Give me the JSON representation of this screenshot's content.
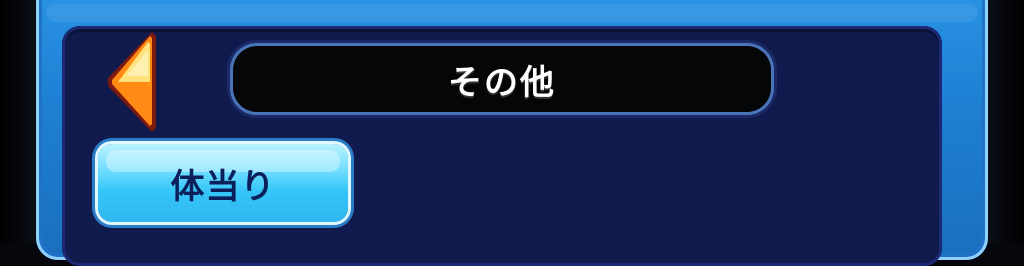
{
  "header": {
    "title": "その他",
    "back_icon": "back-arrow-icon"
  },
  "skills": [
    {
      "label": "体当り"
    }
  ],
  "colors": {
    "outer_panel": "#1e7fd3",
    "inner_panel": "#111a4c",
    "title_bar": "#050608",
    "button": "#35c6f8",
    "button_text": "#0b1f5a",
    "arrow_orange": "#ff9a1f",
    "arrow_yellow": "#ffe27a"
  }
}
